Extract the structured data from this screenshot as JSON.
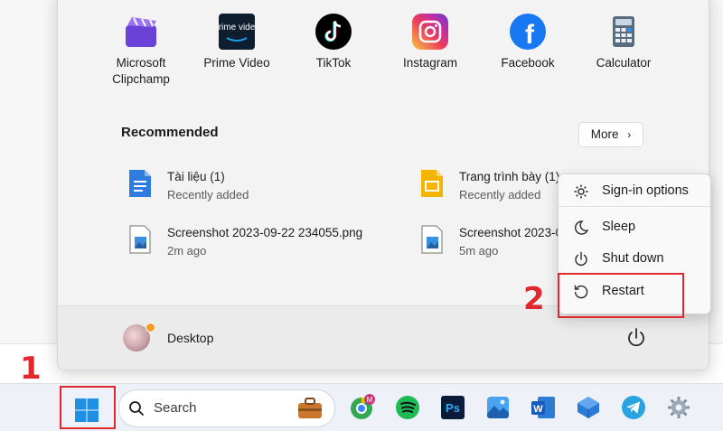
{
  "pinned_apps": [
    {
      "name": "Microsoft Clipchamp",
      "line1": "Microsoft",
      "line2": "Clipchamp",
      "icon": "clipchamp-icon"
    },
    {
      "name": "Prime Video",
      "line1": "Prime Video",
      "line2": "",
      "icon": "prime-video-icon",
      "icon_text": "prime video"
    },
    {
      "name": "TikTok",
      "line1": "TikTok",
      "line2": "",
      "icon": "tiktok-icon"
    },
    {
      "name": "Instagram",
      "line1": "Instagram",
      "line2": "",
      "icon": "instagram-icon"
    },
    {
      "name": "Facebook",
      "line1": "Facebook",
      "line2": "",
      "icon": "facebook-icon",
      "icon_text": "f"
    },
    {
      "name": "Calculator",
      "line1": "Calculator",
      "line2": "",
      "icon": "calculator-icon"
    }
  ],
  "recommended": {
    "title": "Recommended",
    "more_label": "More",
    "items": [
      {
        "name": "Tài liệu (1)",
        "sub": "Recently added",
        "icon": "word-doc-icon"
      },
      {
        "name": "Trang trình bày (1)",
        "sub": "Recently added",
        "icon": "slides-icon"
      },
      {
        "name": "Screenshot 2023-09-22 234055.png",
        "sub": "2m ago",
        "icon": "image-file-icon"
      },
      {
        "name": "Screenshot 2023-0",
        "sub": "5m ago",
        "icon": "image-file-icon"
      }
    ]
  },
  "user": {
    "name": "Desktop"
  },
  "power_menu": {
    "items": [
      {
        "label": "Sign-in options",
        "icon": "gear-icon"
      },
      {
        "label": "Sleep",
        "icon": "moon-icon"
      },
      {
        "label": "Shut down",
        "icon": "power-icon"
      },
      {
        "label": "Restart",
        "icon": "restart-icon"
      }
    ]
  },
  "annotations": {
    "step1": "1",
    "step2": "2",
    "color": "#e0282d"
  },
  "taskbar": {
    "search_placeholder": "Search",
    "icons": [
      "start-icon",
      "search-icon",
      "briefcase-icon",
      "chrome-icon",
      "spotify-icon",
      "photoshop-icon",
      "photos-icon",
      "word-icon",
      "azure-icon",
      "telegram-icon",
      "settings-icon"
    ],
    "badge": "M",
    "photoshop_text": "Ps",
    "word_text": "W"
  },
  "colors": {
    "accent": "#0067c0",
    "highlight": "#e0282d"
  }
}
